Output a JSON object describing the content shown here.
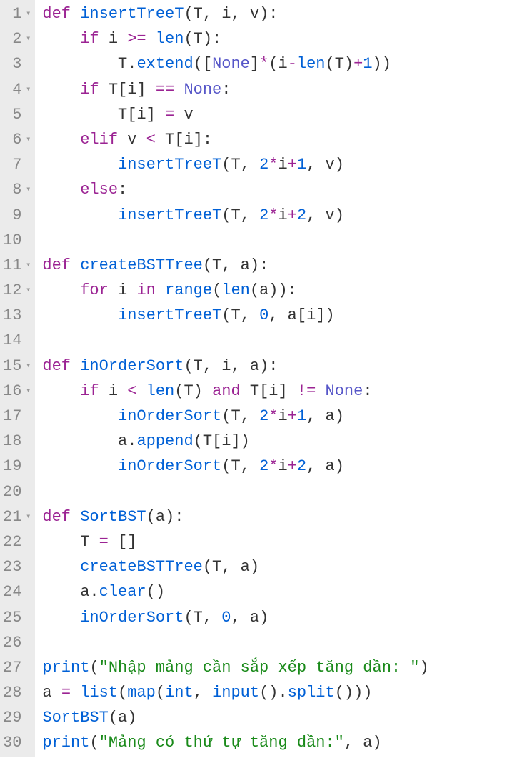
{
  "lines": [
    {
      "n": "1",
      "fold": true,
      "tokens": [
        {
          "t": "def ",
          "c": "kw"
        },
        {
          "t": "insertTreeT",
          "c": "fn"
        },
        {
          "t": "(T, i, v):",
          "c": "paren"
        }
      ],
      "indent": 0
    },
    {
      "n": "2",
      "fold": true,
      "tokens": [
        {
          "t": "if",
          "c": "kw"
        },
        {
          "t": " i ",
          "c": "id"
        },
        {
          "t": ">=",
          "c": "op"
        },
        {
          "t": " ",
          "c": "id"
        },
        {
          "t": "len",
          "c": "fn"
        },
        {
          "t": "(T):",
          "c": "paren"
        }
      ],
      "indent": 1
    },
    {
      "n": "3",
      "fold": false,
      "tokens": [
        {
          "t": "T.",
          "c": "id"
        },
        {
          "t": "extend",
          "c": "fn"
        },
        {
          "t": "([",
          "c": "paren"
        },
        {
          "t": "None",
          "c": "const"
        },
        {
          "t": "]",
          "c": "paren"
        },
        {
          "t": "*",
          "c": "op"
        },
        {
          "t": "(i",
          "c": "paren"
        },
        {
          "t": "-",
          "c": "op"
        },
        {
          "t": "len",
          "c": "fn"
        },
        {
          "t": "(T)",
          "c": "paren"
        },
        {
          "t": "+",
          "c": "op"
        },
        {
          "t": "1",
          "c": "num"
        },
        {
          "t": "))",
          "c": "paren"
        }
      ],
      "indent": 2
    },
    {
      "n": "4",
      "fold": true,
      "tokens": [
        {
          "t": "if",
          "c": "kw"
        },
        {
          "t": " T[i] ",
          "c": "id"
        },
        {
          "t": "==",
          "c": "op"
        },
        {
          "t": " ",
          "c": "id"
        },
        {
          "t": "None",
          "c": "const"
        },
        {
          "t": ":",
          "c": "paren"
        }
      ],
      "indent": 1
    },
    {
      "n": "5",
      "fold": false,
      "tokens": [
        {
          "t": "T[i] ",
          "c": "id"
        },
        {
          "t": "=",
          "c": "op"
        },
        {
          "t": " v",
          "c": "id"
        }
      ],
      "indent": 2
    },
    {
      "n": "6",
      "fold": true,
      "tokens": [
        {
          "t": "elif",
          "c": "kw"
        },
        {
          "t": " v ",
          "c": "id"
        },
        {
          "t": "<",
          "c": "op"
        },
        {
          "t": " T[i]:",
          "c": "id"
        }
      ],
      "indent": 1
    },
    {
      "n": "7",
      "fold": false,
      "tokens": [
        {
          "t": "insertTreeT",
          "c": "fn"
        },
        {
          "t": "(T, ",
          "c": "paren"
        },
        {
          "t": "2",
          "c": "num"
        },
        {
          "t": "*",
          "c": "op"
        },
        {
          "t": "i",
          "c": "id"
        },
        {
          "t": "+",
          "c": "op"
        },
        {
          "t": "1",
          "c": "num"
        },
        {
          "t": ", v)",
          "c": "paren"
        }
      ],
      "indent": 2
    },
    {
      "n": "8",
      "fold": true,
      "tokens": [
        {
          "t": "else",
          "c": "kw"
        },
        {
          "t": ":",
          "c": "paren"
        }
      ],
      "indent": 1
    },
    {
      "n": "9",
      "fold": false,
      "tokens": [
        {
          "t": "insertTreeT",
          "c": "fn"
        },
        {
          "t": "(T, ",
          "c": "paren"
        },
        {
          "t": "2",
          "c": "num"
        },
        {
          "t": "*",
          "c": "op"
        },
        {
          "t": "i",
          "c": "id"
        },
        {
          "t": "+",
          "c": "op"
        },
        {
          "t": "2",
          "c": "num"
        },
        {
          "t": ", v)",
          "c": "paren"
        }
      ],
      "indent": 2
    },
    {
      "n": "10",
      "fold": false,
      "tokens": [],
      "indent": 0
    },
    {
      "n": "11",
      "fold": true,
      "tokens": [
        {
          "t": "def ",
          "c": "kw"
        },
        {
          "t": "createBSTTree",
          "c": "fn"
        },
        {
          "t": "(T, a):",
          "c": "paren"
        }
      ],
      "indent": 0
    },
    {
      "n": "12",
      "fold": true,
      "tokens": [
        {
          "t": "for",
          "c": "kw"
        },
        {
          "t": " i ",
          "c": "id"
        },
        {
          "t": "in",
          "c": "kw"
        },
        {
          "t": " ",
          "c": "id"
        },
        {
          "t": "range",
          "c": "fn"
        },
        {
          "t": "(",
          "c": "paren"
        },
        {
          "t": "len",
          "c": "fn"
        },
        {
          "t": "(a)):",
          "c": "paren"
        }
      ],
      "indent": 1
    },
    {
      "n": "13",
      "fold": false,
      "tokens": [
        {
          "t": "insertTreeT",
          "c": "fn"
        },
        {
          "t": "(T, ",
          "c": "paren"
        },
        {
          "t": "0",
          "c": "num"
        },
        {
          "t": ", a[i])",
          "c": "paren"
        }
      ],
      "indent": 2
    },
    {
      "n": "14",
      "fold": false,
      "tokens": [],
      "indent": 0
    },
    {
      "n": "15",
      "fold": true,
      "tokens": [
        {
          "t": "def ",
          "c": "kw"
        },
        {
          "t": "inOrderSort",
          "c": "fn"
        },
        {
          "t": "(T, i, a):",
          "c": "paren"
        }
      ],
      "indent": 0
    },
    {
      "n": "16",
      "fold": true,
      "tokens": [
        {
          "t": "if",
          "c": "kw"
        },
        {
          "t": " i ",
          "c": "id"
        },
        {
          "t": "<",
          "c": "op"
        },
        {
          "t": " ",
          "c": "id"
        },
        {
          "t": "len",
          "c": "fn"
        },
        {
          "t": "(T) ",
          "c": "paren"
        },
        {
          "t": "and",
          "c": "kw"
        },
        {
          "t": " T[i] ",
          "c": "id"
        },
        {
          "t": "!=",
          "c": "op"
        },
        {
          "t": " ",
          "c": "id"
        },
        {
          "t": "None",
          "c": "const"
        },
        {
          "t": ":",
          "c": "paren"
        }
      ],
      "indent": 1
    },
    {
      "n": "17",
      "fold": false,
      "tokens": [
        {
          "t": "inOrderSort",
          "c": "fn"
        },
        {
          "t": "(T, ",
          "c": "paren"
        },
        {
          "t": "2",
          "c": "num"
        },
        {
          "t": "*",
          "c": "op"
        },
        {
          "t": "i",
          "c": "id"
        },
        {
          "t": "+",
          "c": "op"
        },
        {
          "t": "1",
          "c": "num"
        },
        {
          "t": ", a)",
          "c": "paren"
        }
      ],
      "indent": 2
    },
    {
      "n": "18",
      "fold": false,
      "tokens": [
        {
          "t": "a.",
          "c": "id"
        },
        {
          "t": "append",
          "c": "fn"
        },
        {
          "t": "(T[i])",
          "c": "paren"
        }
      ],
      "indent": 2
    },
    {
      "n": "19",
      "fold": false,
      "tokens": [
        {
          "t": "inOrderSort",
          "c": "fn"
        },
        {
          "t": "(T, ",
          "c": "paren"
        },
        {
          "t": "2",
          "c": "num"
        },
        {
          "t": "*",
          "c": "op"
        },
        {
          "t": "i",
          "c": "id"
        },
        {
          "t": "+",
          "c": "op"
        },
        {
          "t": "2",
          "c": "num"
        },
        {
          "t": ", a)",
          "c": "paren"
        }
      ],
      "indent": 2
    },
    {
      "n": "20",
      "fold": false,
      "tokens": [],
      "indent": 0
    },
    {
      "n": "21",
      "fold": true,
      "tokens": [
        {
          "t": "def ",
          "c": "kw"
        },
        {
          "t": "SortBST",
          "c": "fn"
        },
        {
          "t": "(a):",
          "c": "paren"
        }
      ],
      "indent": 0
    },
    {
      "n": "22",
      "fold": false,
      "tokens": [
        {
          "t": "T ",
          "c": "id"
        },
        {
          "t": "=",
          "c": "op"
        },
        {
          "t": " []",
          "c": "paren"
        }
      ],
      "indent": 1
    },
    {
      "n": "23",
      "fold": false,
      "tokens": [
        {
          "t": "createBSTTree",
          "c": "fn"
        },
        {
          "t": "(T, a)",
          "c": "paren"
        }
      ],
      "indent": 1
    },
    {
      "n": "24",
      "fold": false,
      "tokens": [
        {
          "t": "a.",
          "c": "id"
        },
        {
          "t": "clear",
          "c": "fn"
        },
        {
          "t": "()",
          "c": "paren"
        }
      ],
      "indent": 1
    },
    {
      "n": "25",
      "fold": false,
      "tokens": [
        {
          "t": "inOrderSort",
          "c": "fn"
        },
        {
          "t": "(T, ",
          "c": "paren"
        },
        {
          "t": "0",
          "c": "num"
        },
        {
          "t": ", a)",
          "c": "paren"
        }
      ],
      "indent": 1
    },
    {
      "n": "26",
      "fold": false,
      "tokens": [],
      "indent": 0
    },
    {
      "n": "27",
      "fold": false,
      "tokens": [
        {
          "t": "print",
          "c": "fn"
        },
        {
          "t": "(",
          "c": "paren"
        },
        {
          "t": "\"Nhập mảng cần sắp xếp tăng dần: \"",
          "c": "str"
        },
        {
          "t": ")",
          "c": "paren"
        }
      ],
      "indent": 0
    },
    {
      "n": "28",
      "fold": false,
      "tokens": [
        {
          "t": "a ",
          "c": "id"
        },
        {
          "t": "=",
          "c": "op"
        },
        {
          "t": " ",
          "c": "id"
        },
        {
          "t": "list",
          "c": "fn"
        },
        {
          "t": "(",
          "c": "paren"
        },
        {
          "t": "map",
          "c": "fn"
        },
        {
          "t": "(",
          "c": "paren"
        },
        {
          "t": "int",
          "c": "fn"
        },
        {
          "t": ", ",
          "c": "paren"
        },
        {
          "t": "input",
          "c": "fn"
        },
        {
          "t": "().",
          "c": "paren"
        },
        {
          "t": "split",
          "c": "fn"
        },
        {
          "t": "()))",
          "c": "paren"
        }
      ],
      "indent": 0
    },
    {
      "n": "29",
      "fold": false,
      "tokens": [
        {
          "t": "SortBST",
          "c": "fn"
        },
        {
          "t": "(a)",
          "c": "paren"
        }
      ],
      "indent": 0
    },
    {
      "n": "30",
      "fold": false,
      "tokens": [
        {
          "t": "print",
          "c": "fn"
        },
        {
          "t": "(",
          "c": "paren"
        },
        {
          "t": "\"Mảng có thứ tự tăng dần:\"",
          "c": "str"
        },
        {
          "t": ", a)",
          "c": "paren"
        }
      ],
      "indent": 0
    }
  ]
}
